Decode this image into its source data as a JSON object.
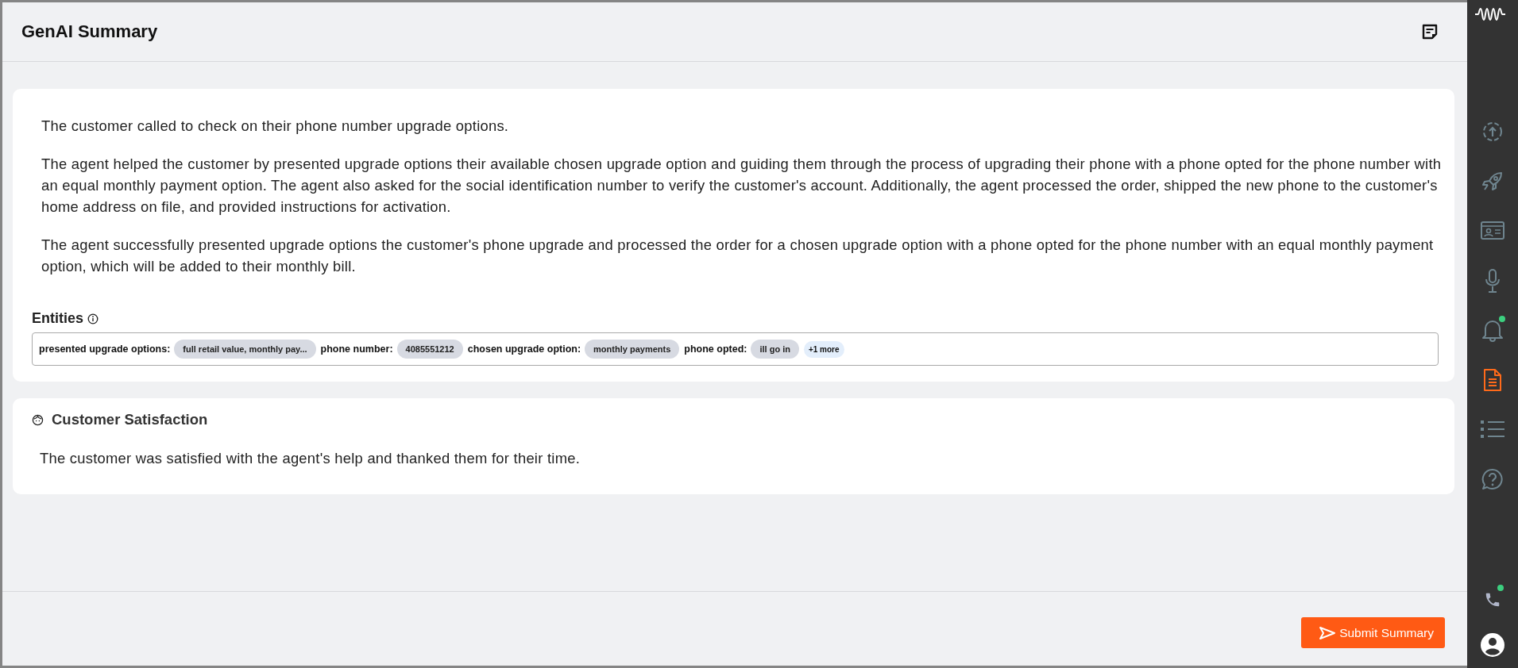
{
  "header": {
    "title": "GenAI Summary"
  },
  "summary": {
    "paragraphs": [
      "The customer called to check on their phone number upgrade options.",
      "The agent helped the customer by presented upgrade options their available chosen upgrade option and guiding them through the process of upgrading their phone with a phone opted for the phone number with an equal monthly payment option. The agent also asked for the social identification number to verify the customer's account. Additionally, the agent processed the order, shipped the new phone to the customer's home address on file, and provided instructions for activation.",
      "The agent successfully presented upgrade options the customer's phone upgrade and processed the order for a chosen upgrade option with a phone opted for the phone number with an equal monthly payment option, which will be added to their monthly bill."
    ]
  },
  "entities": {
    "title": "Entities",
    "items": [
      {
        "label": "presented upgrade options:",
        "value": "full retail value, monthly pay..."
      },
      {
        "label": "phone number:",
        "value": "4085551212"
      },
      {
        "label": "chosen upgrade option:",
        "value": "monthly payments"
      },
      {
        "label": "phone opted:",
        "value": "ill go in"
      }
    ],
    "more": "+1 more"
  },
  "satisfaction": {
    "title": "Customer Satisfaction",
    "text": "The customer was satisfied with the agent's help and thanked them for their time."
  },
  "submit_button": "Submit Summary",
  "sidebar": {
    "items": [
      {
        "kind": "upload",
        "selected": false,
        "badge": false
      },
      {
        "kind": "rocket",
        "selected": false,
        "badge": false
      },
      {
        "kind": "id-card",
        "selected": false,
        "badge": false
      },
      {
        "kind": "mic",
        "selected": false,
        "badge": false
      },
      {
        "kind": "bell",
        "selected": false,
        "badge": true
      },
      {
        "kind": "document",
        "selected": true,
        "badge": false
      },
      {
        "kind": "list",
        "selected": false,
        "badge": false
      },
      {
        "kind": "help",
        "selected": false,
        "badge": false
      }
    ],
    "phone": {
      "badge": true
    }
  }
}
